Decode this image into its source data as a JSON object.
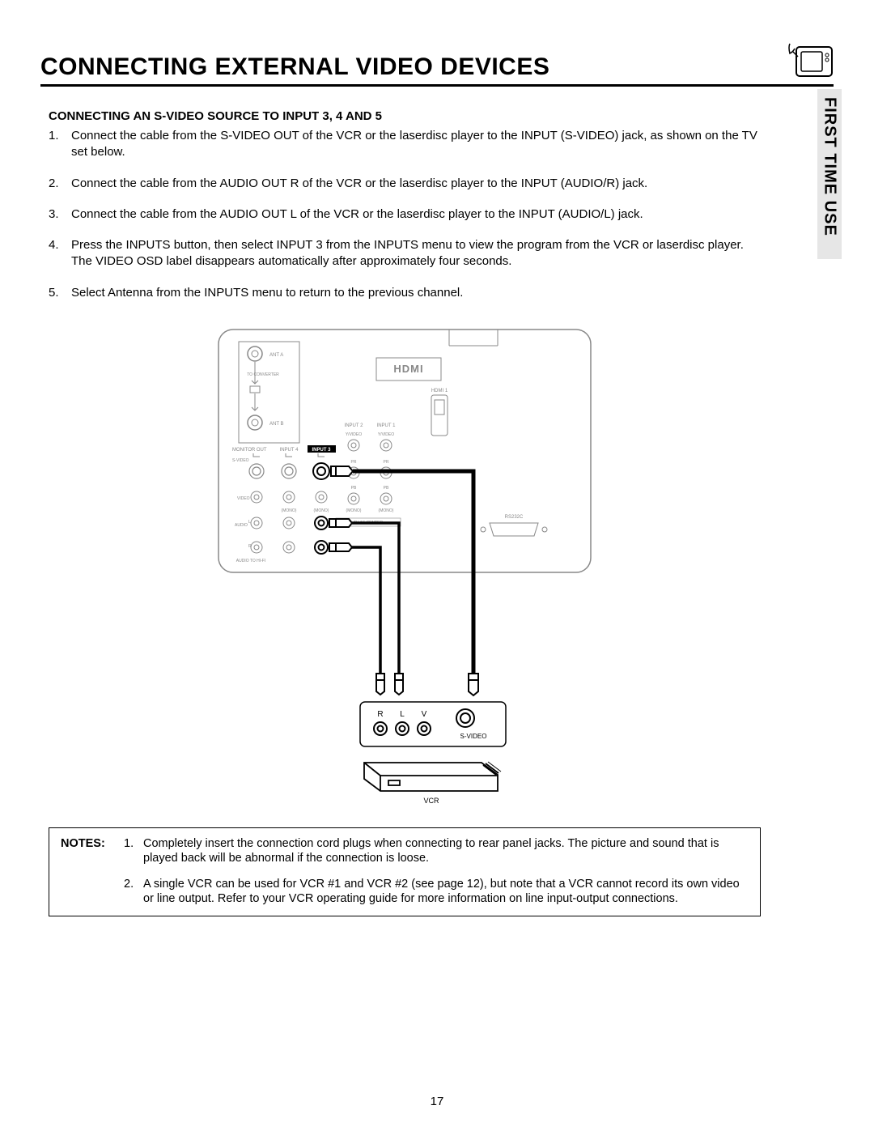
{
  "page": {
    "title": "CONNECTING EXTERNAL VIDEO DEVICES",
    "side_tab": "FIRST TIME USE",
    "page_number": "17"
  },
  "section": {
    "heading": "CONNECTING AN S-VIDEO SOURCE TO INPUT 3, 4 AND 5",
    "steps": [
      {
        "n": "1.",
        "text": "Connect the cable from the S-VIDEO OUT of the VCR or the laserdisc player to the INPUT (S-VIDEO) jack, as shown on the TV set below."
      },
      {
        "n": "2.",
        "text": "Connect the cable from the AUDIO OUT R of the VCR or the laserdisc player to the INPUT (AUDIO/R) jack."
      },
      {
        "n": "3.",
        "text": "Connect the cable from the AUDIO OUT L of the VCR or the laserdisc player to the INPUT (AUDIO/L) jack."
      },
      {
        "n": "4.",
        "text": "Press the INPUTS button, then select INPUT 3 from the INPUTS menu to view the program from the VCR or laserdisc player. The VIDEO OSD label disappears automatically after approximately four seconds."
      },
      {
        "n": "5.",
        "text": "Select Antenna from the INPUTS menu to return to the previous channel."
      }
    ]
  },
  "diagram": {
    "labels": {
      "ant_a": "ANT A",
      "to_converter": "TO CONVERTER",
      "ant_b": "ANT B",
      "hdmi_logo": "HDMI",
      "hdmi1": "HDMI 1",
      "input1": "INPUT 1",
      "input2": "INPUT 2",
      "input3": "INPUT 3",
      "input4": "INPUT 4",
      "monitor_out": "MONITOR OUT",
      "s_video": "S-VIDEO",
      "video": "VIDEO",
      "y_video": "Y/VIDEO",
      "pr": "PR",
      "pb": "PB",
      "mono": "(MONO)",
      "audio": "AUDIO",
      "tv_as_center": "TV AS CENTER",
      "rs232c": "RS232C",
      "audio_to_hifi": "AUDIO TO HI-FI",
      "l": "L",
      "r": "R",
      "v": "V",
      "vcr": "VCR"
    }
  },
  "notes": {
    "label": "NOTES:",
    "items": [
      {
        "n": "1.",
        "text": "Completely insert the connection cord plugs when connecting to rear panel jacks.  The picture and sound that is played back will be abnormal if the connection is loose."
      },
      {
        "n": "2.",
        "text": "A single VCR can be used for VCR #1 and VCR #2 (see page 12), but note that a VCR cannot record its own video or line output.  Refer to your VCR operating guide for more information on line input-output connections."
      }
    ]
  }
}
